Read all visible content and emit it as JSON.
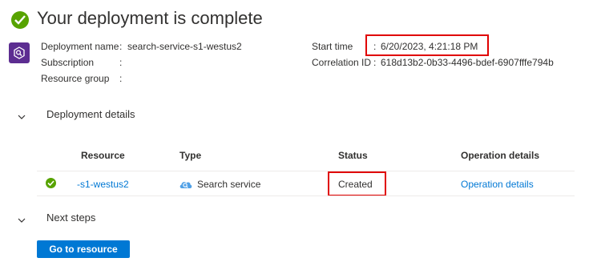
{
  "header": {
    "title": "Your deployment is complete"
  },
  "summary": {
    "deployment_name_label": "Deployment name",
    "deployment_name_value": "search-service-s1-westus2",
    "subscription_label": "Subscription",
    "subscription_value": "",
    "resource_group_label": "Resource group",
    "resource_group_value": "",
    "start_time_label": "Start time",
    "start_time_value": "6/20/2023, 4:21:18 PM",
    "correlation_label": "Correlation ID",
    "correlation_value": "618d13b2-0b33-4496-bdef-6907fffe794b",
    "colon": ":"
  },
  "details": {
    "section_title": "Deployment details",
    "columns": [
      "Resource",
      "Type",
      "Status",
      "Operation details"
    ],
    "rows": [
      {
        "resource": "-s1-westus2",
        "type": "Search service",
        "status": "Created",
        "operation": "Operation details"
      }
    ]
  },
  "next_steps": {
    "section_title": "Next steps",
    "go_button": "Go to resource"
  },
  "colors": {
    "accent": "#0078d4",
    "success": "#57a300",
    "highlight": "#e00000",
    "service_icon": "#5c2d91"
  }
}
